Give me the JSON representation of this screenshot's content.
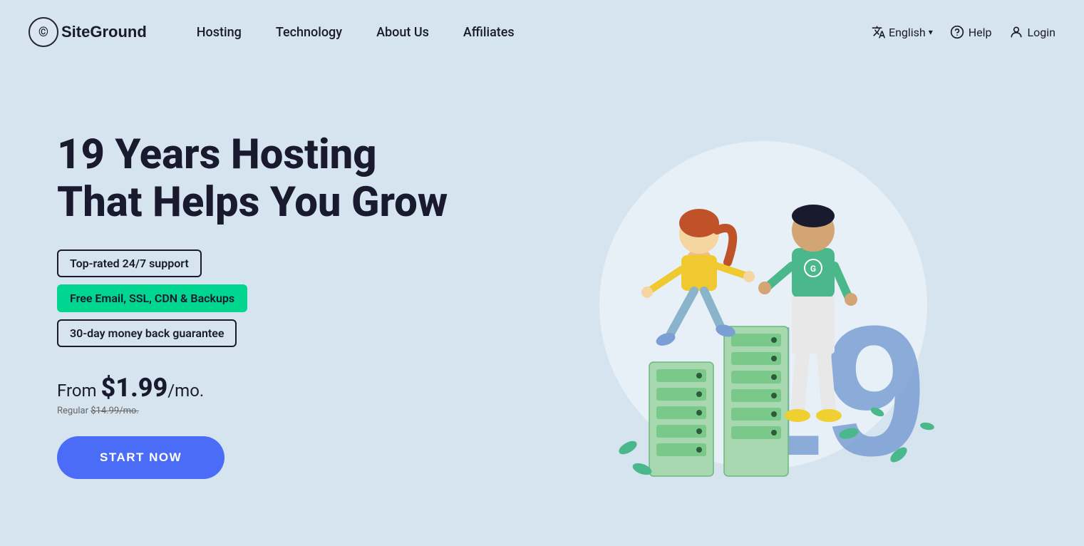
{
  "nav": {
    "logo_text": "SiteGround",
    "links": [
      {
        "label": "Hosting",
        "id": "hosting"
      },
      {
        "label": "Technology",
        "id": "technology"
      },
      {
        "label": "About Us",
        "id": "about-us"
      },
      {
        "label": "Affiliates",
        "id": "affiliates"
      }
    ],
    "right": {
      "language": "English",
      "help": "Help",
      "login": "Login"
    }
  },
  "hero": {
    "title_line1": "19 Years Hosting",
    "title_line2": "That Helps You Grow",
    "badges": [
      {
        "text": "Top-rated 24/7 support",
        "style": "outline"
      },
      {
        "text": "Free Email, SSL, CDN & Backups",
        "style": "green"
      },
      {
        "text": "30-day money back guarantee",
        "style": "outline"
      }
    ],
    "price_from_label": "From",
    "price_amount": "$1.99",
    "price_period": "/mo.",
    "price_regular_label": "Regular",
    "price_regular_value": "$14.99/mo.",
    "cta_button": "START NOW"
  },
  "colors": {
    "bg": "#d6e4f0",
    "accent_blue": "#4a6cf7",
    "accent_green": "#00d68f",
    "text_dark": "#1a1a2e"
  }
}
